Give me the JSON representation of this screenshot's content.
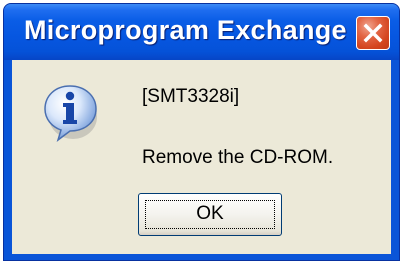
{
  "window": {
    "title": "Microprogram  Exchange"
  },
  "icons": {
    "close": "close-icon",
    "info": "info-icon"
  },
  "message": {
    "model": "[SMT3328i]",
    "text": "Remove the CD-ROM."
  },
  "buttons": {
    "ok_label": "OK"
  },
  "colors": {
    "titlebar": "#0a55d8",
    "client_background": "#ece9d8",
    "close_button": "#d4451f"
  }
}
